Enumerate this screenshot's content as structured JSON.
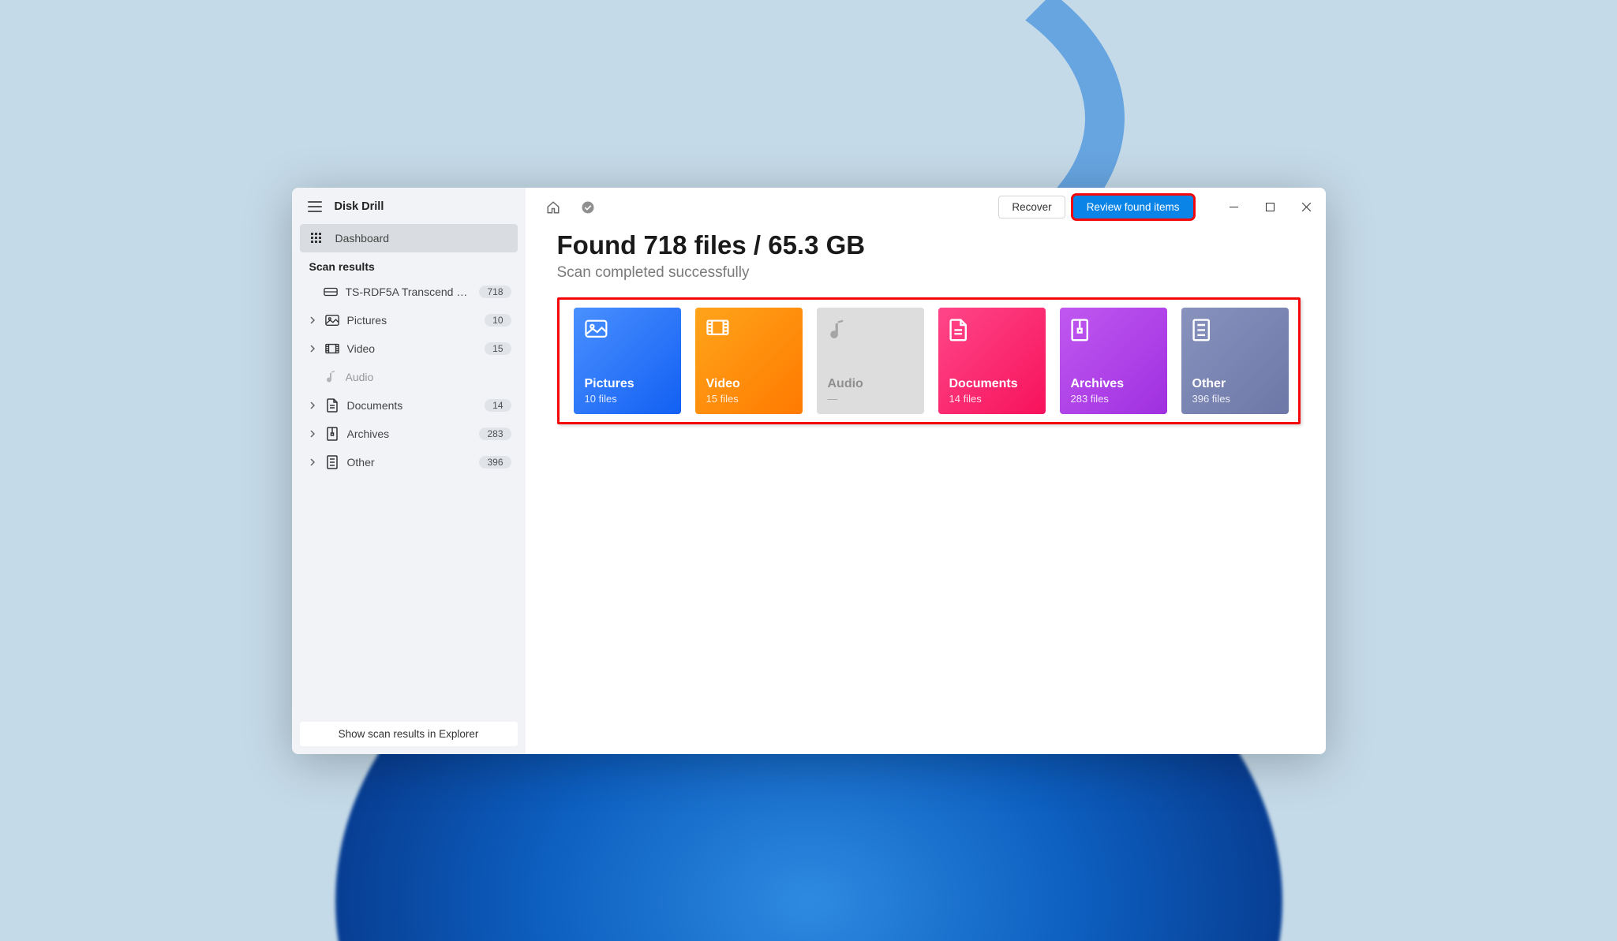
{
  "app": {
    "title": "Disk Drill"
  },
  "sidebar": {
    "dashboard_label": "Dashboard",
    "section_label": "Scan results",
    "items": [
      {
        "label": "TS-RDF5A Transcend US…",
        "badge": "718",
        "icon": "drive",
        "expandable": false,
        "muted": false
      },
      {
        "label": "Pictures",
        "badge": "10",
        "icon": "picture",
        "expandable": true,
        "muted": false
      },
      {
        "label": "Video",
        "badge": "15",
        "icon": "video",
        "expandable": true,
        "muted": false
      },
      {
        "label": "Audio",
        "badge": "",
        "icon": "audio",
        "expandable": false,
        "muted": true
      },
      {
        "label": "Documents",
        "badge": "14",
        "icon": "document",
        "expandable": true,
        "muted": false
      },
      {
        "label": "Archives",
        "badge": "283",
        "icon": "archive",
        "expandable": true,
        "muted": false
      },
      {
        "label": "Other",
        "badge": "396",
        "icon": "other",
        "expandable": true,
        "muted": false
      }
    ],
    "footer_btn": "Show scan results in Explorer"
  },
  "toolbar": {
    "recover_label": "Recover",
    "review_label": "Review found items"
  },
  "main": {
    "heading": "Found 718 files / 65.3 GB",
    "subheading": "Scan completed successfully",
    "cards": [
      {
        "title": "Pictures",
        "sub": "10 files",
        "color": "blue",
        "icon": "picture"
      },
      {
        "title": "Video",
        "sub": "15 files",
        "color": "orange",
        "icon": "video"
      },
      {
        "title": "Audio",
        "sub": "—",
        "color": "grey",
        "icon": "audio"
      },
      {
        "title": "Documents",
        "sub": "14 files",
        "color": "pink",
        "icon": "document"
      },
      {
        "title": "Archives",
        "sub": "283 files",
        "color": "purple",
        "icon": "archive"
      },
      {
        "title": "Other",
        "sub": "396 files",
        "color": "slate",
        "icon": "other"
      }
    ]
  }
}
